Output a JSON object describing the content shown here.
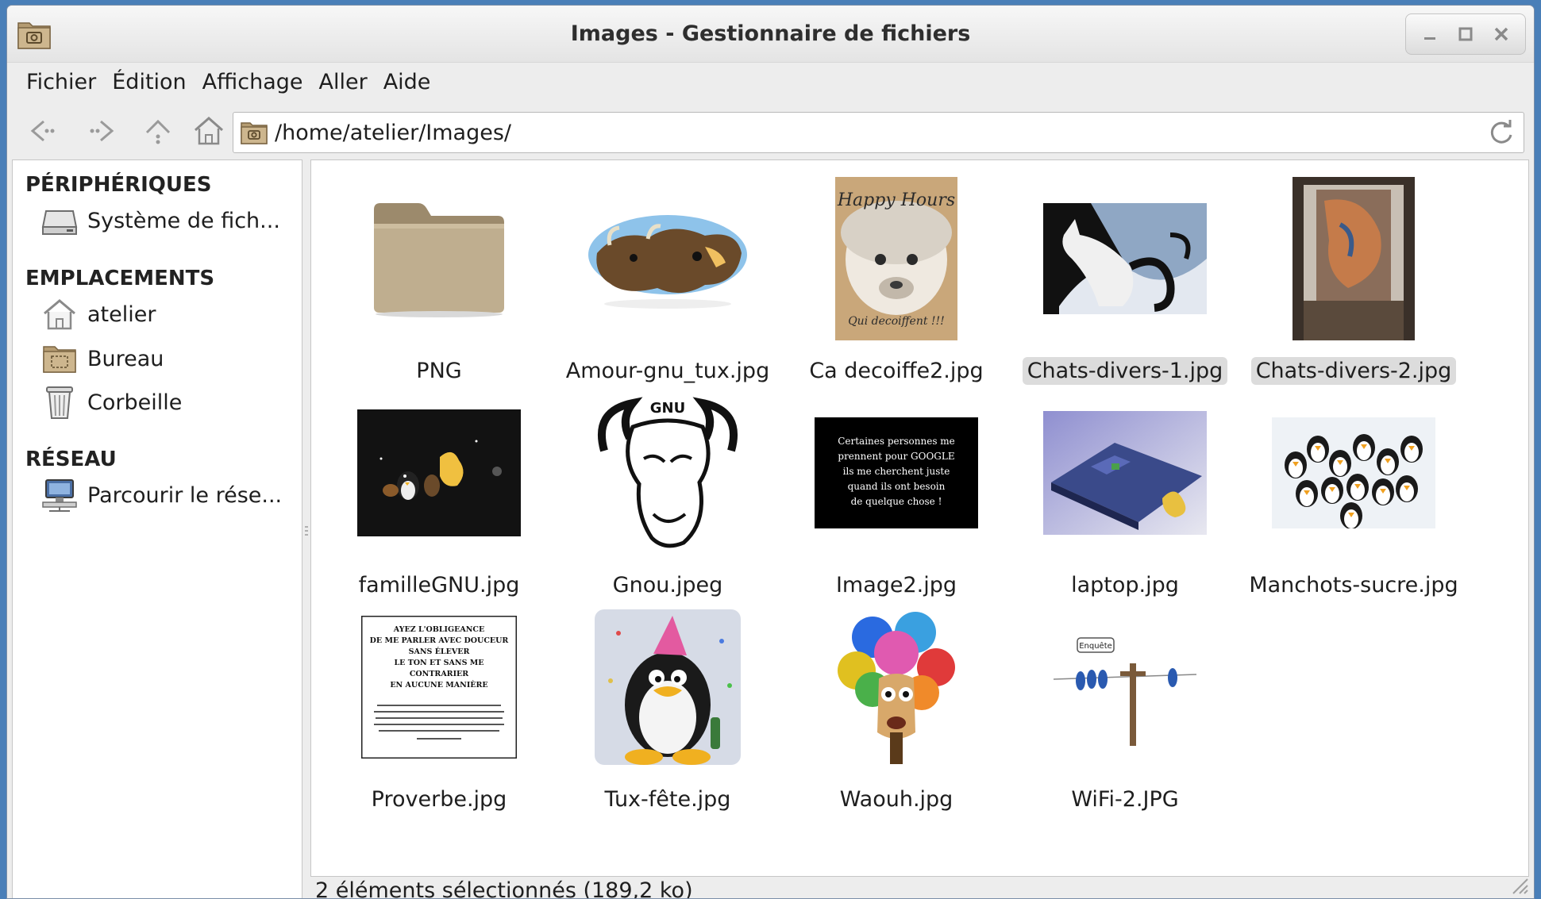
{
  "window": {
    "title": "Images - Gestionnaire de fichiers",
    "minimize_icon": "minimize-icon",
    "maximize_icon": "maximize-icon",
    "close_icon": "close-icon"
  },
  "menubar": {
    "items": [
      {
        "label": "Fichier"
      },
      {
        "label": "Édition"
      },
      {
        "label": "Affichage"
      },
      {
        "label": "Aller"
      },
      {
        "label": "Aide"
      }
    ]
  },
  "toolbar": {
    "back_icon": "back-arrow-icon",
    "forward_icon": "forward-arrow-icon",
    "up_icon": "up-arrow-icon",
    "home_icon": "home-icon",
    "location": "/home/atelier/Images/",
    "reload_icon": "reload-icon"
  },
  "sidebar": {
    "sections": [
      {
        "heading": "PÉRIPHÉRIQUES",
        "items": [
          {
            "label": "Système de fich...",
            "icon": "drive-icon"
          }
        ]
      },
      {
        "heading": "EMPLACEMENTS",
        "items": [
          {
            "label": "atelier",
            "icon": "home-folder-icon"
          },
          {
            "label": "Bureau",
            "icon": "desktop-folder-icon"
          },
          {
            "label": "Corbeille",
            "icon": "trash-icon"
          }
        ]
      },
      {
        "heading": "RÉSEAU",
        "items": [
          {
            "label": "Parcourir le rése...",
            "icon": "network-icon"
          }
        ]
      }
    ]
  },
  "files": [
    {
      "name": "PNG",
      "type": "folder",
      "selected": false
    },
    {
      "name": "Amour-gnu_tux.jpg",
      "type": "image",
      "selected": false
    },
    {
      "name": "Ca decoiffe2.jpg",
      "type": "image",
      "selected": false
    },
    {
      "name": "Chats-divers-1.jpg",
      "type": "image",
      "selected": true
    },
    {
      "name": "Chats-divers-2.jpg",
      "type": "image",
      "selected": true
    },
    {
      "name": "familleGNU.jpg",
      "type": "image",
      "selected": false
    },
    {
      "name": "Gnou.jpeg",
      "type": "image",
      "selected": false
    },
    {
      "name": "Image2.jpg",
      "type": "image",
      "selected": false
    },
    {
      "name": "laptop.jpg",
      "type": "image",
      "selected": false
    },
    {
      "name": "Manchots-sucre.jpg",
      "type": "image",
      "selected": false
    },
    {
      "name": "Proverbe.jpg",
      "type": "image",
      "selected": false
    },
    {
      "name": "Tux-fête.jpg",
      "type": "image",
      "selected": false
    },
    {
      "name": "Waouh.jpg",
      "type": "image",
      "selected": false
    },
    {
      "name": "WiFi-2.JPG",
      "type": "image",
      "selected": false
    }
  ],
  "thumbnails": {
    "Ca decoiffe2.jpg": {
      "text1": "Happy Hours",
      "text2": "Qui decoiffent !!!"
    },
    "Gnou.jpeg": {
      "text": "GNU"
    },
    "Image2.jpg": {
      "lines": [
        "Certaines personnes me",
        "prennent pour GOOGLE",
        "ils me cherchent juste",
        "quand ils ont besoin",
        "de quelque chose !"
      ]
    },
    "Proverbe.jpg": {
      "lines": [
        "AYEZ L'OBLIGEANCE",
        "DE ME PARLER AVEC DOUCEUR",
        "SANS ÉLEVER",
        "LE TON ET SANS ME",
        "CONTRARIER",
        "EN AUCUNE MANIÈRE"
      ]
    },
    "WiFi-2.JPG": {
      "text": "Enquête"
    }
  },
  "statusbar": {
    "text": "2 éléments sélectionnés (189,2 ko)"
  },
  "colors": {
    "desktop": "#4a7fb8",
    "selection": "#dcdcdc",
    "folder": "#b8a88a"
  }
}
